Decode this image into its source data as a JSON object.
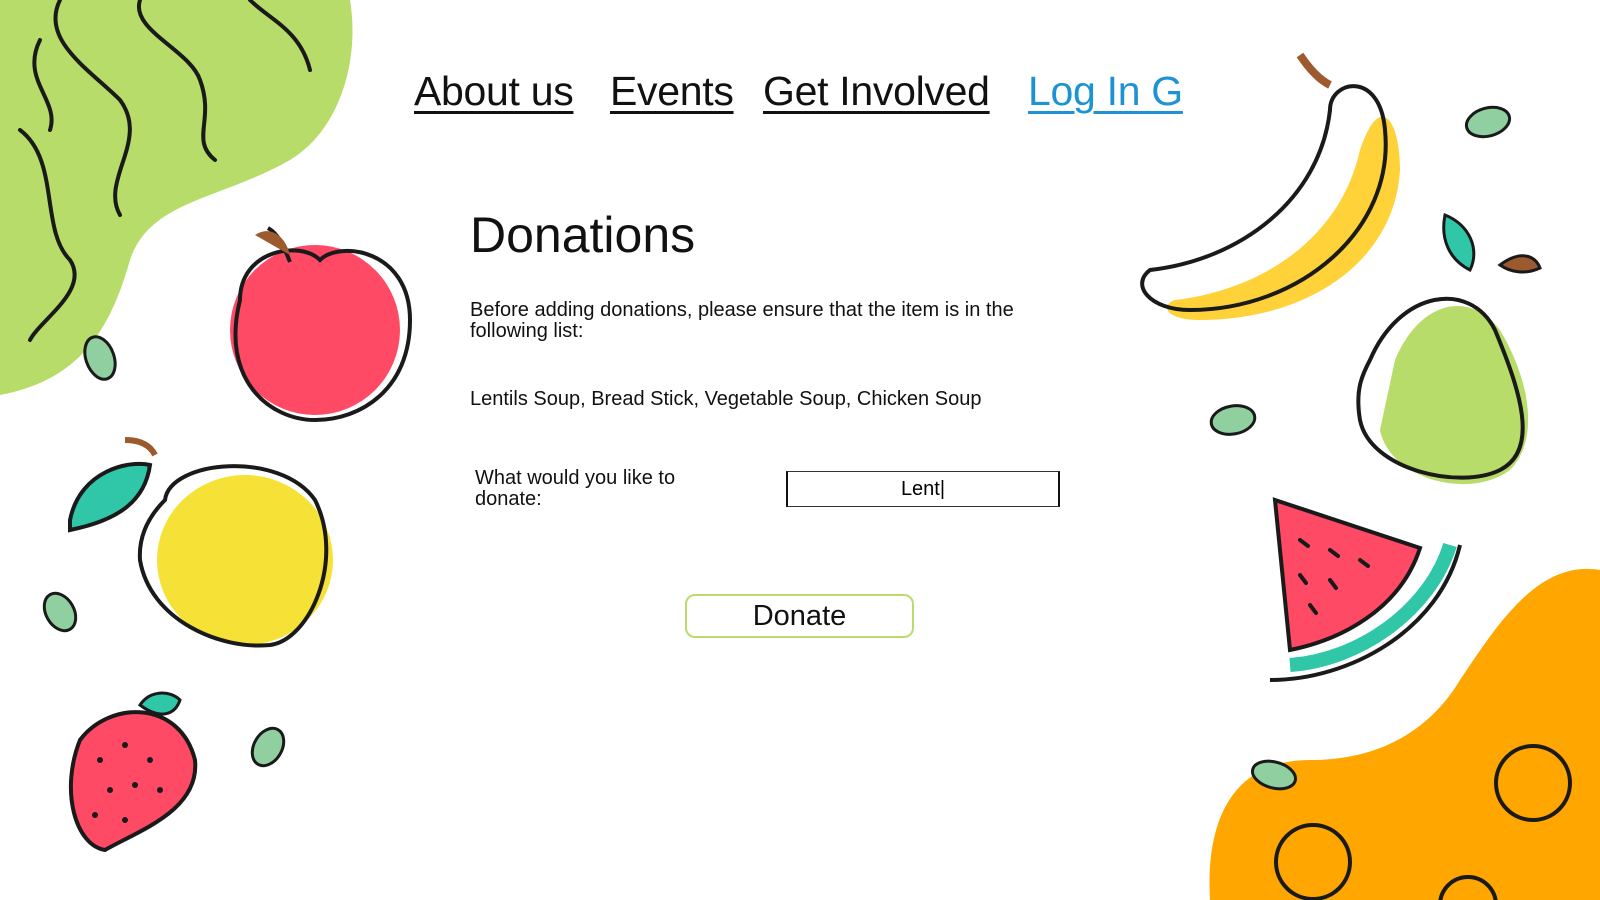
{
  "nav": {
    "items": [
      {
        "label": "About us"
      },
      {
        "label": "Events"
      },
      {
        "label": "Get Involved"
      },
      {
        "label": "Log In G"
      }
    ]
  },
  "main": {
    "title": "Donations",
    "note": "Before adding donations, please ensure that the item is  in the following list:",
    "allowed_items": "Lentils Soup, Bread Stick, Vegetable Soup, Chicken Soup",
    "question": "What would you like to donate:",
    "input_value": "Lent|",
    "donate_label": "Donate"
  },
  "colors": {
    "active_link": "#1d93d3",
    "button_border": "#b9dd6c",
    "green_blob": "#b8dc6a",
    "orange_blob": "#ffa600"
  }
}
